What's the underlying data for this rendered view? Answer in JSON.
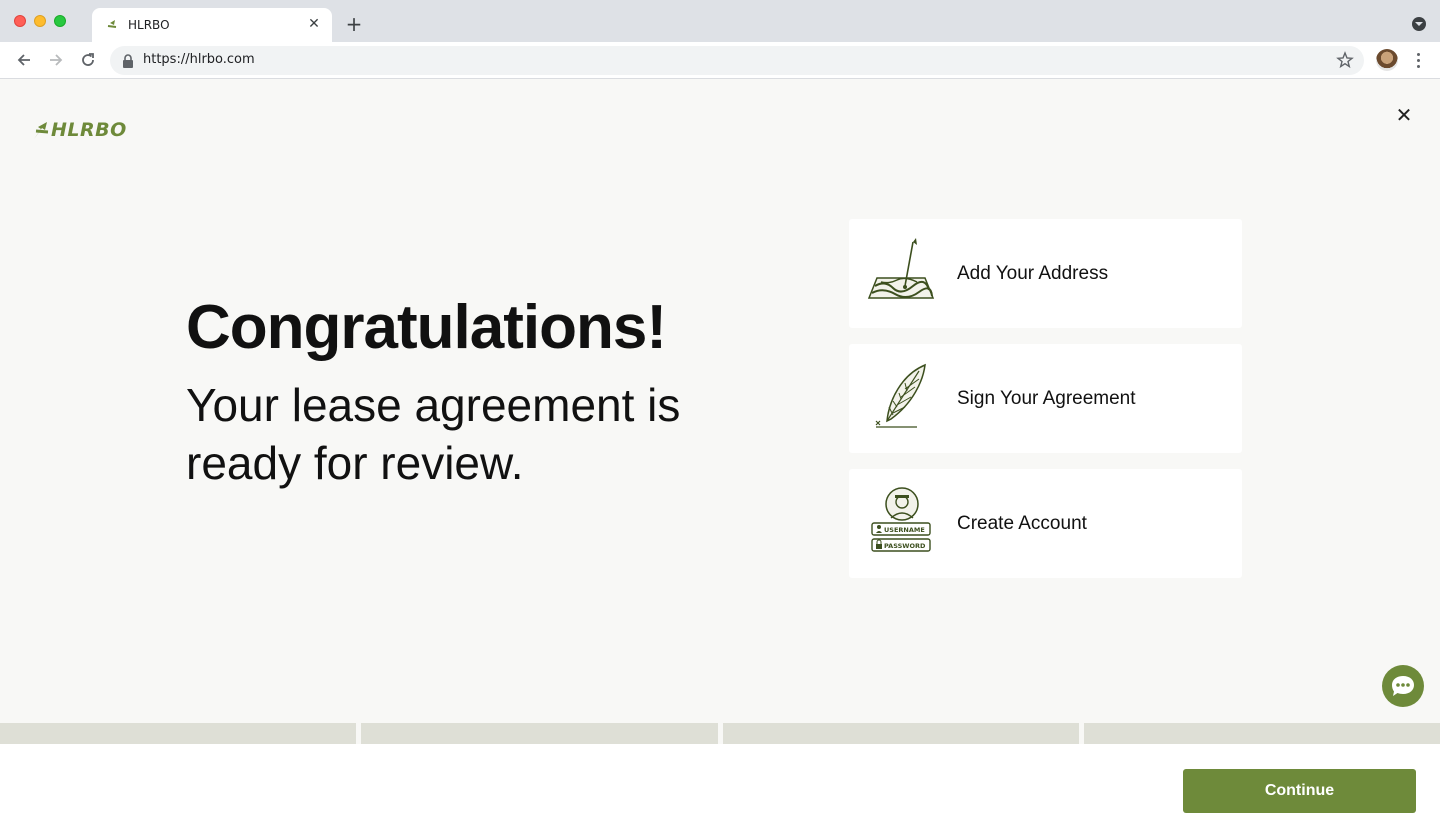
{
  "browser": {
    "tab_title": "HLRBO",
    "tab_close_glyph": "✕",
    "new_tab_glyph": "+",
    "url": "https://hlrbo.com"
  },
  "page": {
    "logo_text": "HLRBO",
    "close_glyph": "✕",
    "headline": "Congratulations!",
    "subline": "Your lease agreement is ready for review.",
    "steps": [
      {
        "label": "Add Your Address",
        "icon": "map-pin-icon"
      },
      {
        "label": "Sign Your Agreement",
        "icon": "quill-pen-icon"
      },
      {
        "label": "Create Account",
        "icon": "account-credentials-icon"
      }
    ],
    "account_icon_labels": {
      "username": "USERNAME",
      "password": "PASSWORD"
    },
    "progress_segments": 4,
    "continue_label": "Continue"
  },
  "colors": {
    "brand_green": "#6e8a3a",
    "page_bg": "#f8f8f6",
    "progress_track": "#dedfd6"
  }
}
